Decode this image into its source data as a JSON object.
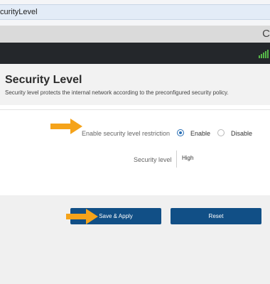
{
  "browser": {
    "url_text": "curityLevel",
    "toolbar_partial_char": "C"
  },
  "page": {
    "title": "Security Level",
    "subtitle": "Security level protects the internal network according to the preconfigured security policy."
  },
  "form": {
    "restriction_label": "Enable security level restriction",
    "enable_label": "Enable",
    "disable_label": "Disable",
    "selected_option": "Enable",
    "security_level_label": "Security level",
    "security_level_value": "High"
  },
  "actions": {
    "save_label": "Save & Apply",
    "reset_label": "Reset"
  },
  "colors": {
    "primary_button": "#114f86",
    "annotation_arrow": "#f5a31a",
    "signal_indicator": "#56b849",
    "status_bar": "#24272b"
  },
  "annotations": {
    "arrow_icon": "right-arrow-icon"
  }
}
